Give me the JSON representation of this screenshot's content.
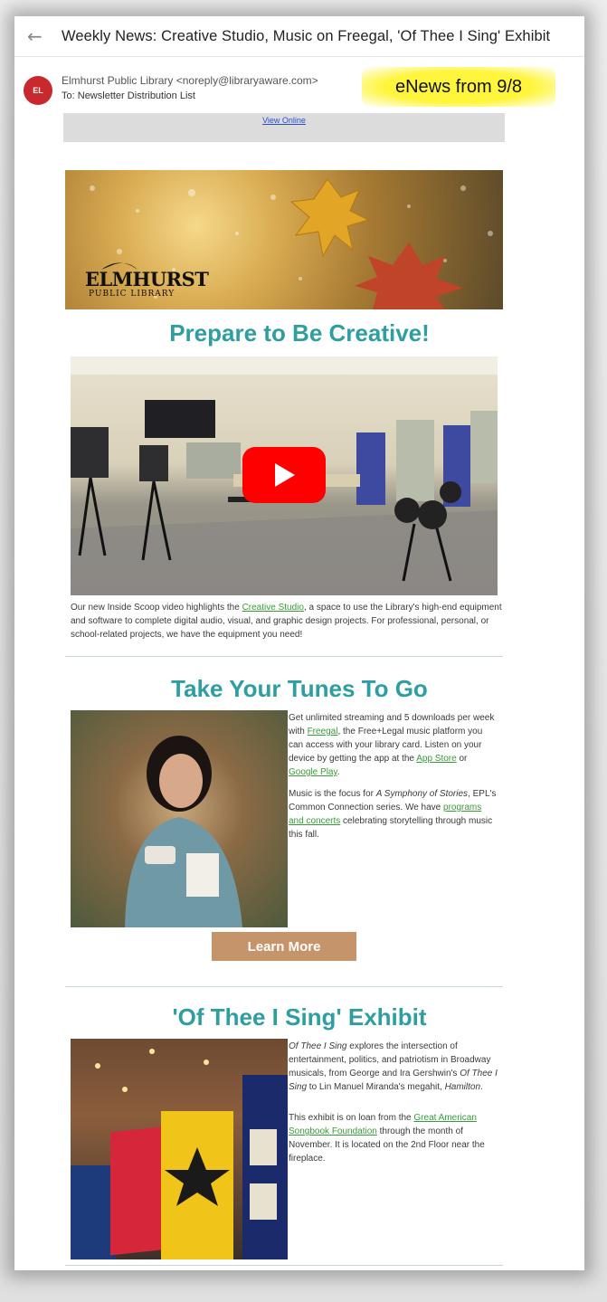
{
  "subject": "Weekly News: Creative Studio, Music on Freegal, 'Of Thee I Sing' Exhibit",
  "sender": {
    "initials": "EL",
    "from": "Elmhurst Public Library <noreply@libraryaware.com>",
    "to_label": "To:",
    "to_value": "Newsletter Distribution List"
  },
  "note": "eNews from 9/8",
  "view_online": "View Online",
  "banner": {
    "logo": "ELMHURST",
    "logo_sub": "PUBLIC LIBRARY"
  },
  "section1": {
    "heading": "Prepare to Be Creative!",
    "text_before": "Our new Inside Scoop video highlights the ",
    "link": "Creative Studio",
    "text_after": ", a space to use the Library's high-end equipment and software to complete digital audio, visual, and graphic design projects. For professional, personal, or school-related projects, we have the equipment you need!"
  },
  "section2": {
    "heading": "Take Your Tunes To Go",
    "p1_a": "Get unlimited streaming and 5 downloads per week with ",
    "p1_link1": "Freegal",
    "p1_b": ", the Free+Legal music platform you can access with your library card. Listen on your device by getting the app at the ",
    "p1_link2": "App Store",
    "p1_c": " or ",
    "p1_link3": "Google Play",
    "p1_d": ".",
    "p2_a": "Music is the focus for ",
    "p2_italic": "A Symphony of Stories",
    "p2_b": ", EPL's Common Connection series. We have ",
    "p2_link": "programs and concerts",
    "p2_c": " celebrating storytelling through music this fall.",
    "button": "Learn More"
  },
  "section3": {
    "heading": "'Of Thee I Sing' Exhibit",
    "p1_italic": "Of Thee I Sing",
    "p1_a": " explores the intersection of entertainment, politics, and patriotism in Broadway musicals, from George and Ira Gershwin's ",
    "p1_italic2": "Of Thee I Sing",
    "p1_b": " to Lin Manuel Miranda's megahit, ",
    "p1_italic3": "Hamilton",
    "p1_c": ".",
    "p2_a": "This exhibit is on loan from the ",
    "p2_link": "Great American Songbook Foundation",
    "p2_b": " through the month of November. It is located on the 2nd Floor near the fireplace."
  },
  "colors": {
    "heading": "#2f9ea0",
    "button": "#c6946a",
    "link": "#3a9a3a",
    "avatar": "#c8282e",
    "highlight": "#fff53d"
  }
}
